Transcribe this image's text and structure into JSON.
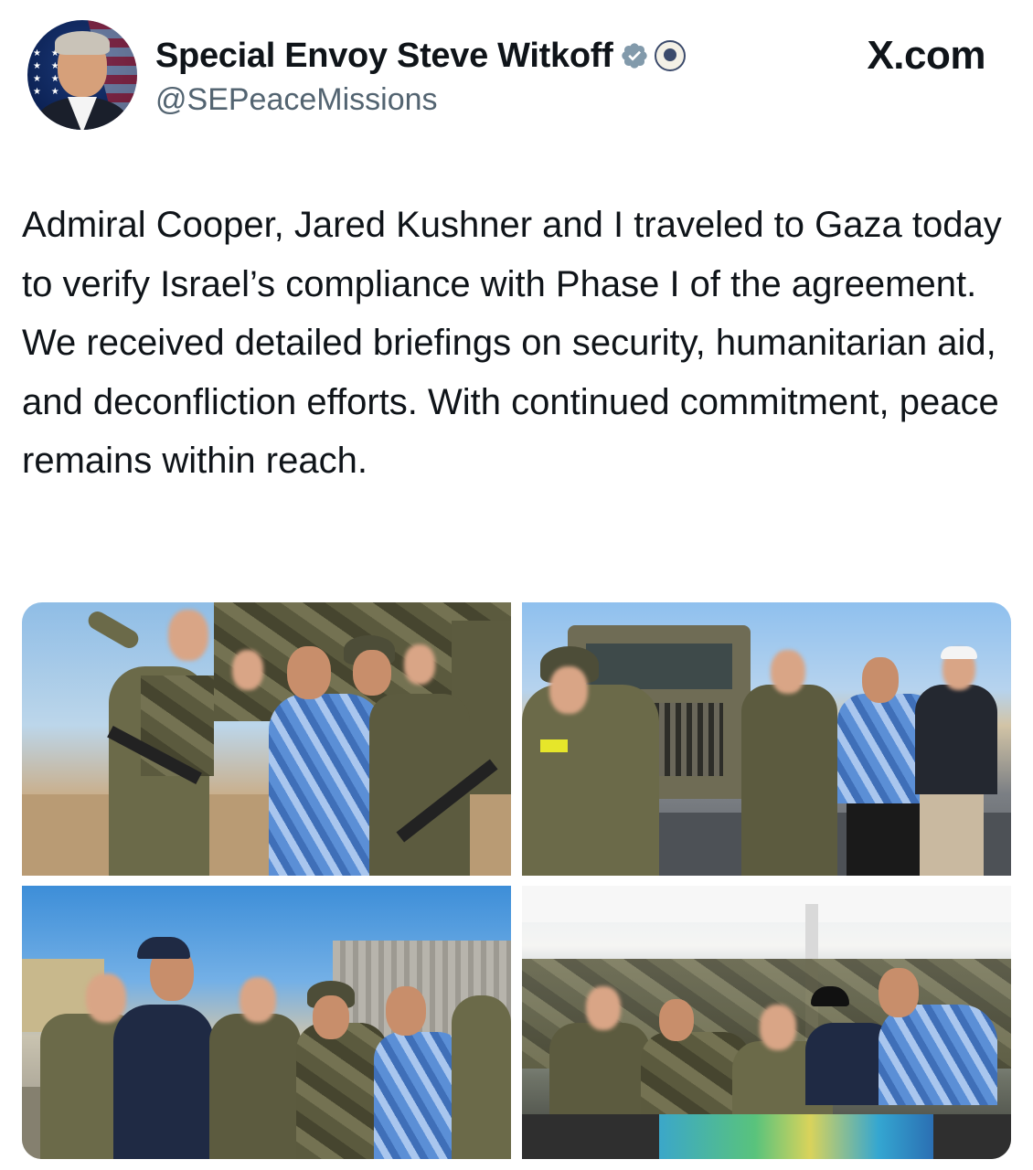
{
  "author": {
    "display_name": "Special Envoy Steve Witkoff",
    "handle": "@SEPeaceMissions"
  },
  "source": "X.com",
  "tweet": {
    "text": "Admiral Cooper, Jared Kushner and I traveled to Gaza today to verify Israel’s compliance with Phase I of the agreement. We received detailed briefings on security, humanitarian aid, and deconfliction efforts. With continued commitment, peace remains within reach."
  },
  "media": {
    "count": 4
  },
  "colors": {
    "verified_badge": "#829aab",
    "text_primary": "#0f1419",
    "text_secondary": "#536471"
  },
  "icons": {
    "verified": "verified-badge-icon",
    "affiliation": "state-department-seal-icon"
  }
}
